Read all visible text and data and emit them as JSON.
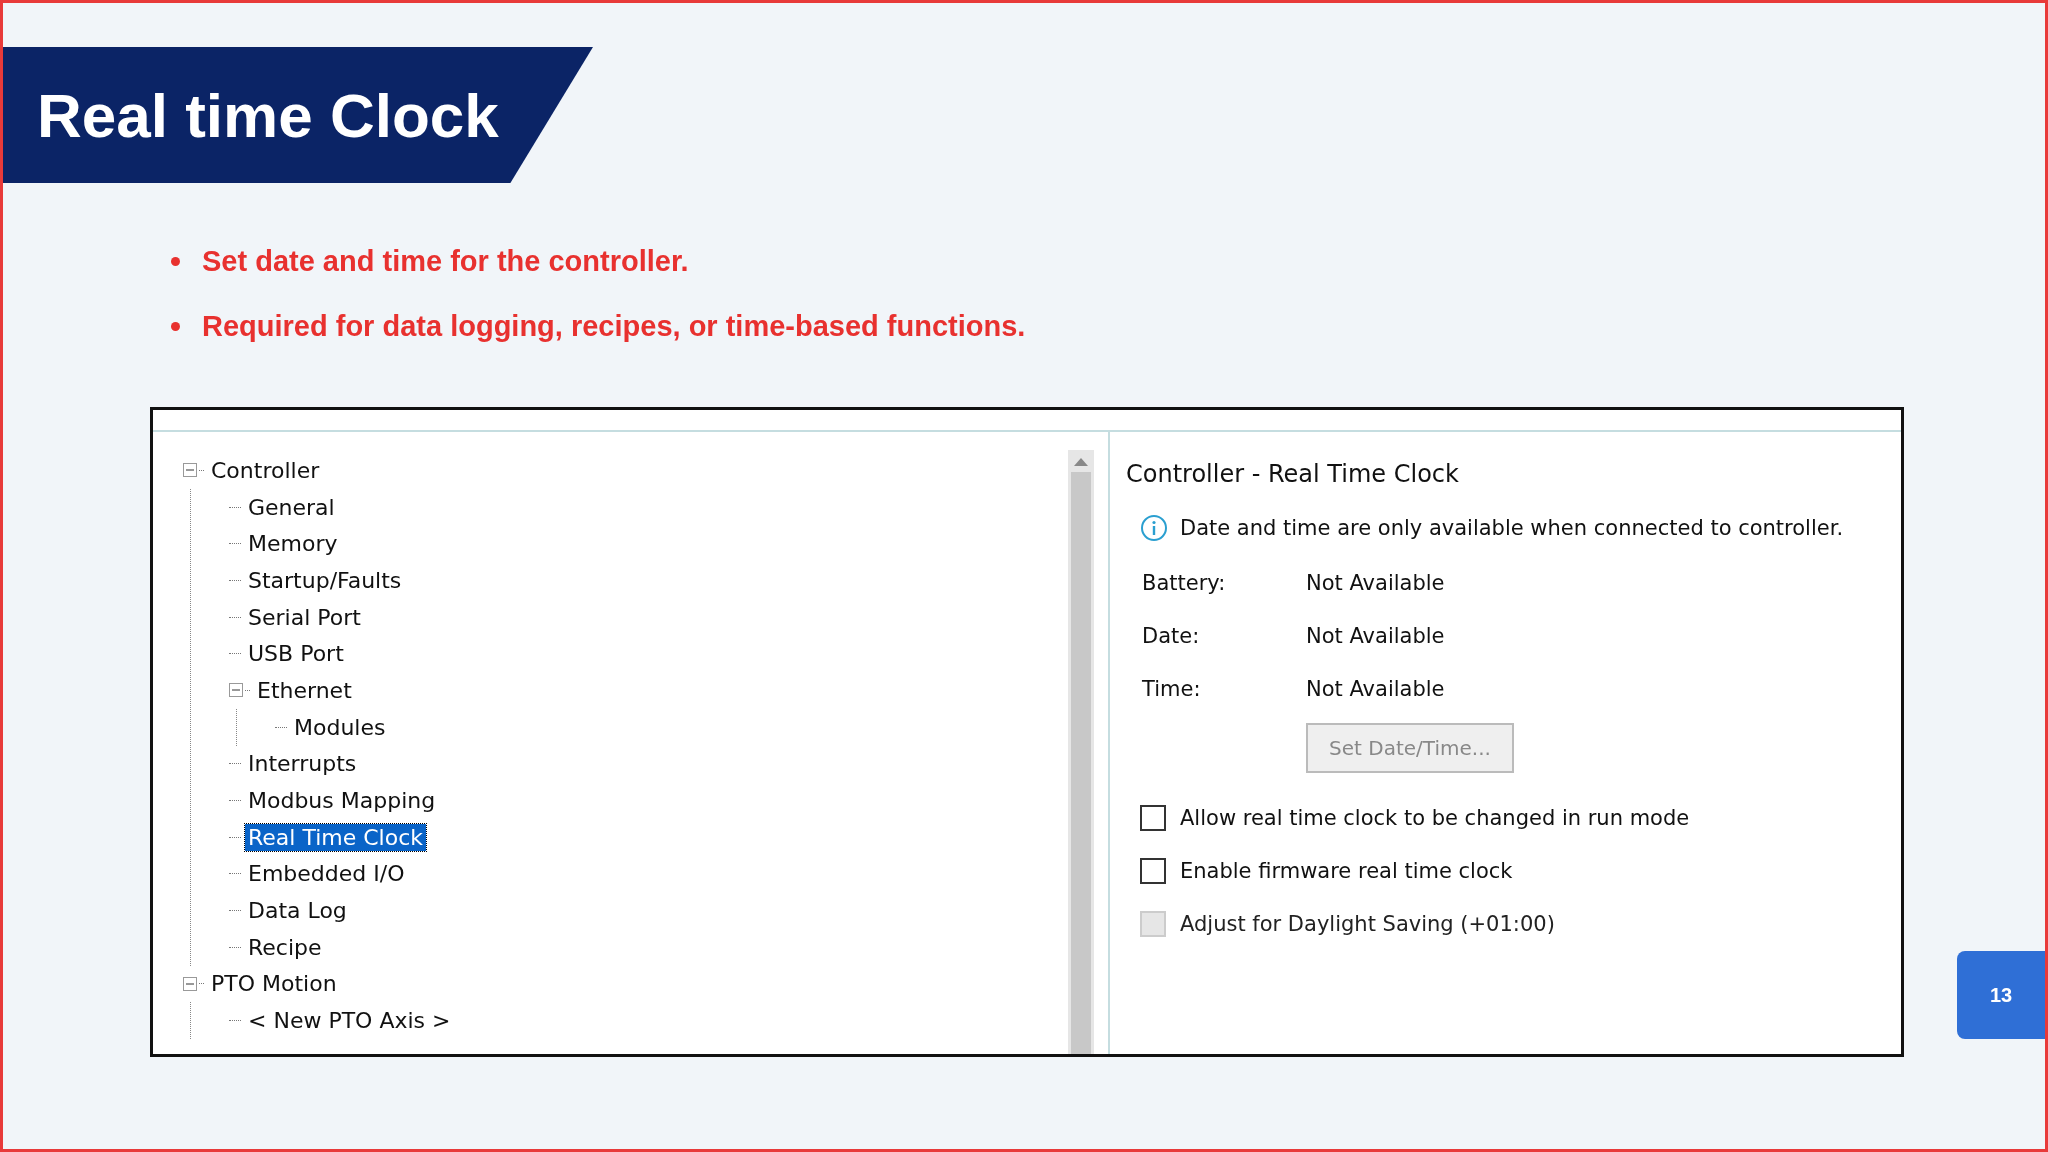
{
  "slide": {
    "title": "Real time Clock",
    "bullets": [
      "Set date and time for the controller.",
      "Required for data logging, recipes, or time-based functions."
    ],
    "page_number": "13"
  },
  "tree": [
    {
      "label": "Controller",
      "expanded": true,
      "selected": false,
      "children": [
        {
          "label": "General",
          "selected": false
        },
        {
          "label": "Memory",
          "selected": false
        },
        {
          "label": "Startup/Faults",
          "selected": false
        },
        {
          "label": "Serial Port",
          "selected": false
        },
        {
          "label": "USB Port",
          "selected": false
        },
        {
          "label": "Ethernet",
          "expanded": true,
          "selected": false,
          "children": [
            {
              "label": "Modules",
              "selected": false
            }
          ]
        },
        {
          "label": "Interrupts",
          "selected": false
        },
        {
          "label": "Modbus Mapping",
          "selected": false
        },
        {
          "label": "Real Time Clock",
          "selected": true
        },
        {
          "label": "Embedded I/O",
          "selected": false
        },
        {
          "label": "Data Log",
          "selected": false
        },
        {
          "label": "Recipe",
          "selected": false
        }
      ]
    },
    {
      "label": "PTO Motion",
      "expanded": true,
      "selected": false,
      "children": [
        {
          "label": "< New PTO Axis >",
          "selected": false
        }
      ]
    }
  ],
  "panel": {
    "title": "Controller - Real Time Clock",
    "info": "Date and time are only available when connected to controller.",
    "fields": [
      {
        "label": "Battery:",
        "value": "Not Available"
      },
      {
        "label": "Date:",
        "value": "Not Available"
      },
      {
        "label": "Time:",
        "value": "Not Available"
      }
    ],
    "button": {
      "label": "Set Date/Time...",
      "disabled": true
    },
    "options": [
      {
        "label": "Allow real time clock to be changed in run mode",
        "checked": false,
        "disabled": false
      },
      {
        "label": "Enable firmware real time clock",
        "checked": false,
        "disabled": false
      },
      {
        "label": "Adjust for Daylight Saving (+01:00)",
        "checked": false,
        "disabled": true
      }
    ]
  }
}
